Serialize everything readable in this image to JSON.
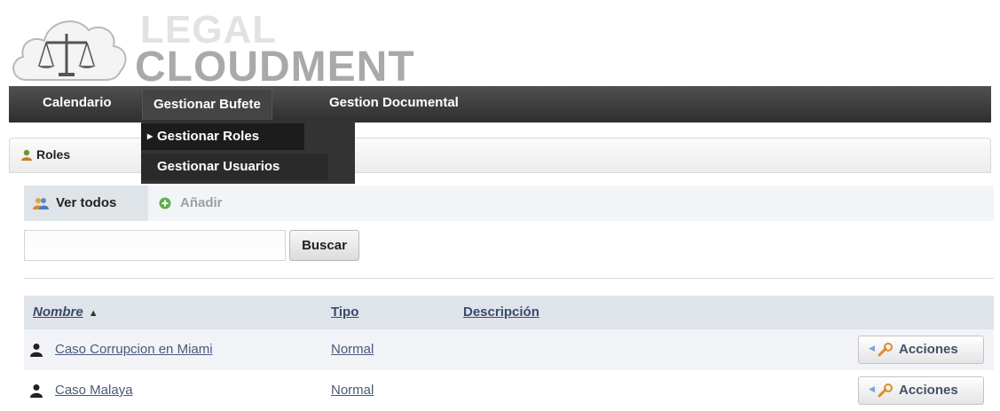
{
  "logo": {
    "line1": "LEGAL",
    "line2": "CLOUDMENT"
  },
  "nav": {
    "items": [
      {
        "label": "Calendario"
      },
      {
        "label": "Gestionar Bufete",
        "active": true
      },
      {
        "label": "Gestion Documental"
      }
    ],
    "dropdown": [
      {
        "label": "Gestionar Roles",
        "selected": true
      },
      {
        "label": "Gestionar Usuarios"
      }
    ]
  },
  "panel": {
    "title": "Roles",
    "icon": "user-group-icon"
  },
  "tabs": {
    "view_all": "Ver todos",
    "add": "Añadir"
  },
  "search": {
    "value": "",
    "button_label": "Buscar"
  },
  "table": {
    "columns": [
      "Nombre",
      "Tipo",
      "Descripción"
    ],
    "sort_indicator": "▲",
    "rows": [
      {
        "name": "Caso Corrupcion en Miami",
        "tipo": "Normal",
        "descripcion": "",
        "action": "Acciones"
      },
      {
        "name": "Caso Malaya",
        "tipo": "Normal",
        "descripcion": "",
        "action": "Acciones"
      }
    ]
  },
  "colors": {
    "navbar": "#3a3a3a",
    "dropdown": "#333333",
    "link": "#4a5a7a",
    "header_row": "#dfe4ea"
  }
}
